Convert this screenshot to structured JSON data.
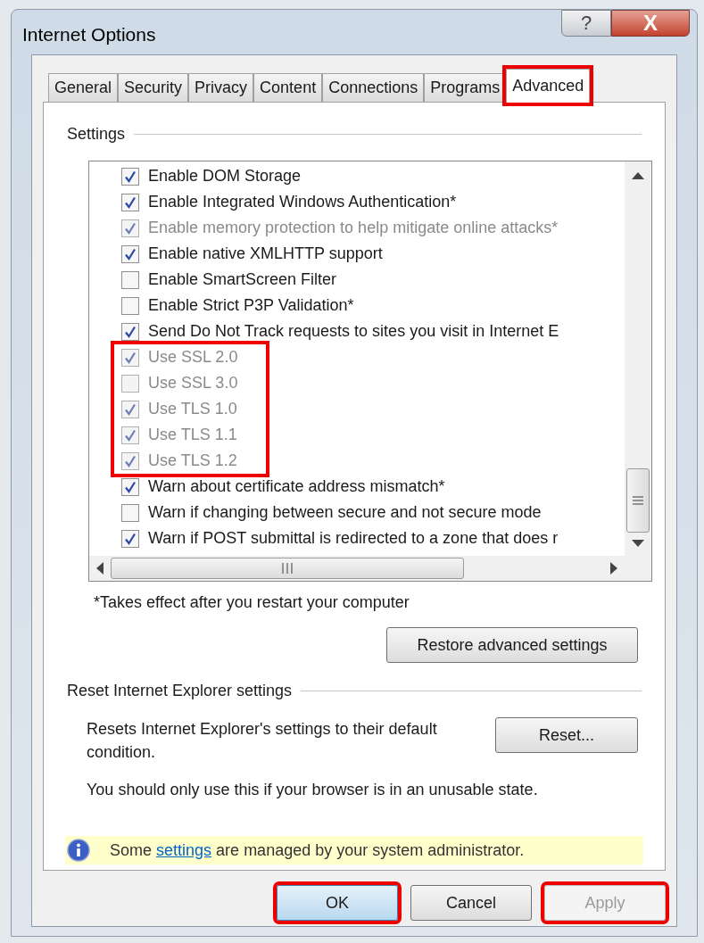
{
  "window": {
    "title": "Internet Options",
    "help_button": "?",
    "close_button": "X"
  },
  "tabs": [
    {
      "label": "General",
      "selected": false,
      "highlighted": false
    },
    {
      "label": "Security",
      "selected": false,
      "highlighted": false
    },
    {
      "label": "Privacy",
      "selected": false,
      "highlighted": false
    },
    {
      "label": "Content",
      "selected": false,
      "highlighted": false
    },
    {
      "label": "Connections",
      "selected": false,
      "highlighted": false
    },
    {
      "label": "Programs",
      "selected": false,
      "highlighted": false
    },
    {
      "label": "Advanced",
      "selected": true,
      "highlighted": true
    }
  ],
  "settings": {
    "title": "Settings",
    "items": [
      {
        "label": "Enable DOM Storage",
        "checked": true,
        "disabled": false,
        "highlighted": false
      },
      {
        "label": "Enable Integrated Windows Authentication*",
        "checked": true,
        "disabled": false,
        "highlighted": false
      },
      {
        "label": "Enable memory protection to help mitigate online attacks*",
        "checked": true,
        "disabled": true,
        "highlighted": false
      },
      {
        "label": "Enable native XMLHTTP support",
        "checked": true,
        "disabled": false,
        "highlighted": false
      },
      {
        "label": "Enable SmartScreen Filter",
        "checked": false,
        "disabled": false,
        "highlighted": false
      },
      {
        "label": "Enable Strict P3P Validation*",
        "checked": false,
        "disabled": false,
        "highlighted": false
      },
      {
        "label": "Send Do Not Track requests to sites you visit in Internet E",
        "checked": true,
        "disabled": false,
        "highlighted": false
      },
      {
        "label": "Use SSL 2.0",
        "checked": true,
        "disabled": true,
        "highlighted": true
      },
      {
        "label": "Use SSL 3.0",
        "checked": false,
        "disabled": true,
        "highlighted": true
      },
      {
        "label": "Use TLS 1.0",
        "checked": true,
        "disabled": true,
        "highlighted": true
      },
      {
        "label": "Use TLS 1.1",
        "checked": true,
        "disabled": true,
        "highlighted": true
      },
      {
        "label": "Use TLS 1.2",
        "checked": true,
        "disabled": true,
        "highlighted": true
      },
      {
        "label": "Warn about certificate address mismatch*",
        "checked": true,
        "disabled": false,
        "highlighted": false
      },
      {
        "label": "Warn if changing between secure and not secure mode",
        "checked": false,
        "disabled": false,
        "highlighted": false
      },
      {
        "label": "Warn if POST submittal is redirected to a zone that does r",
        "checked": true,
        "disabled": false,
        "highlighted": false
      }
    ],
    "note": "*Takes effect after you restart your computer",
    "restore_button": "Restore advanced settings"
  },
  "reset": {
    "title": "Reset Internet Explorer settings",
    "description": "Resets Internet Explorer's settings to their default condition.",
    "button": "Reset...",
    "warning": "You should only use this if your browser is in an unusable state."
  },
  "info_bar": {
    "before": "Some",
    "link": "settings",
    "after": "are managed by your system administrator."
  },
  "buttons": [
    {
      "label": "OK",
      "default": true,
      "disabled": false,
      "highlighted": true
    },
    {
      "label": "Cancel",
      "default": false,
      "disabled": false,
      "highlighted": false
    },
    {
      "label": "Apply",
      "default": false,
      "disabled": true,
      "highlighted": true
    }
  ]
}
